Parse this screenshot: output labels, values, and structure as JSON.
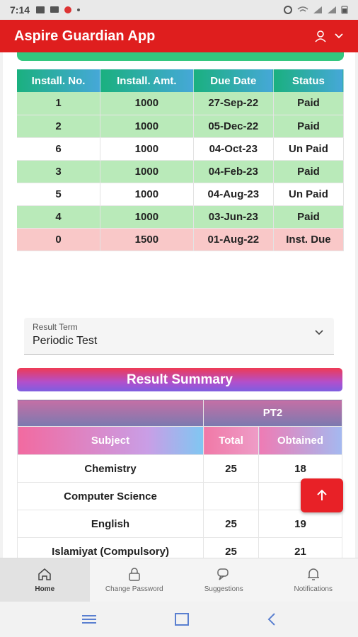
{
  "status_bar": {
    "time": "7:14"
  },
  "app": {
    "title": "Aspire Guardian App"
  },
  "installments": {
    "headers": [
      "Install. No.",
      "Install. Amt.",
      "Due Date",
      "Status"
    ],
    "rows": [
      {
        "no": "1",
        "amt": "1000",
        "date": "27-Sep-22",
        "status": "Paid",
        "kind": "paid"
      },
      {
        "no": "2",
        "amt": "1000",
        "date": "05-Dec-22",
        "status": "Paid",
        "kind": "paid"
      },
      {
        "no": "6",
        "amt": "1000",
        "date": "04-Oct-23",
        "status": "Un Paid",
        "kind": "unpaid"
      },
      {
        "no": "3",
        "amt": "1000",
        "date": "04-Feb-23",
        "status": "Paid",
        "kind": "paid"
      },
      {
        "no": "5",
        "amt": "1000",
        "date": "04-Aug-23",
        "status": "Un Paid",
        "kind": "unpaid"
      },
      {
        "no": "4",
        "amt": "1000",
        "date": "03-Jun-23",
        "status": "Paid",
        "kind": "paid"
      },
      {
        "no": "0",
        "amt": "1500",
        "date": "01-Aug-22",
        "status": "Inst. Due",
        "kind": "due"
      }
    ]
  },
  "result_term": {
    "label": "Result Term",
    "value": "Periodic Test"
  },
  "result_summary": {
    "title": "Result Summary",
    "exam": "PT2",
    "headers": {
      "subject": "Subject",
      "total": "Total",
      "obtained": "Obtained"
    },
    "rows": [
      {
        "subject": "Chemistry",
        "total": "25",
        "obtained": "18"
      },
      {
        "subject": "Computer Science",
        "total": "",
        "obtained": ""
      },
      {
        "subject": "English",
        "total": "25",
        "obtained": "19"
      },
      {
        "subject": "Islamiyat (Compulsory)",
        "total": "25",
        "obtained": "21"
      }
    ]
  },
  "bottom_nav": [
    {
      "label": "Home",
      "icon": "home-icon",
      "active": true
    },
    {
      "label": "Change Password",
      "icon": "lock-icon",
      "active": false
    },
    {
      "label": "Suggestions",
      "icon": "chat-icon",
      "active": false
    },
    {
      "label": "Notifications",
      "icon": "bell-icon",
      "active": false
    }
  ],
  "colors": {
    "appbar": "#df1e1e",
    "paid_row": "#b9eab9",
    "due_row": "#f9c8c8",
    "fab": "#e82127"
  }
}
